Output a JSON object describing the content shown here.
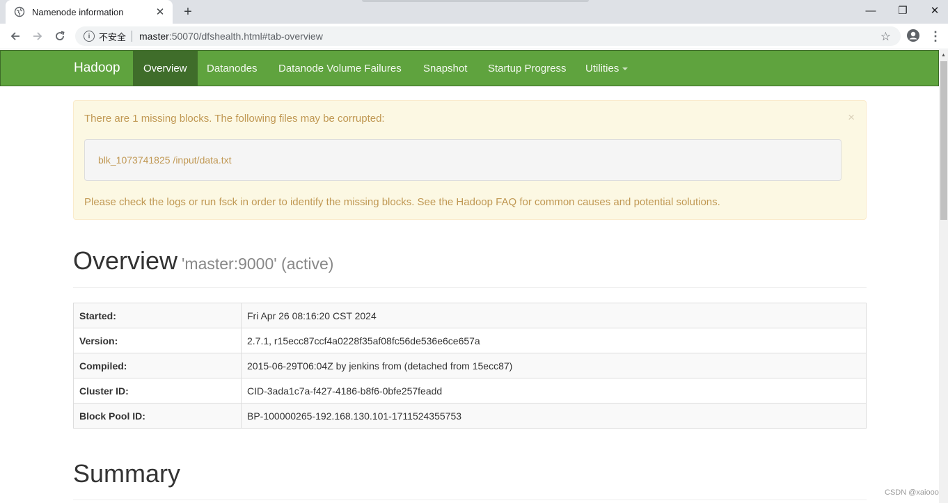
{
  "browser": {
    "tab_title": "Namenode information",
    "tab_close": "✕",
    "new_tab": "+",
    "window_controls": {
      "minimize": "—",
      "restore": "❐",
      "close": "✕"
    },
    "security_label": "不安全",
    "url_host": "master",
    "url_rest": ":50070/dfshealth.html#tab-overview",
    "icons": [
      "back-arrow-icon",
      "forward-arrow-icon",
      "reload-icon",
      "info-icon",
      "star-icon",
      "profile-icon",
      "menu-dots-icon"
    ]
  },
  "navbar": {
    "brand": "Hadoop",
    "items": [
      {
        "label": "Overview",
        "active": true
      },
      {
        "label": "Datanodes"
      },
      {
        "label": "Datanode Volume Failures"
      },
      {
        "label": "Snapshot"
      },
      {
        "label": "Startup Progress"
      },
      {
        "label": "Utilities"
      }
    ],
    "colors": {
      "bar": "#5fa33e",
      "active": "#3f6d2a"
    }
  },
  "alert": {
    "message": "There are 1 missing blocks. The following files may be corrupted:",
    "block": "blk_1073741825 /input/data.txt",
    "advice": "Please check the logs or run fsck in order to identify the missing blocks. See the Hadoop FAQ for common causes and potential solutions.",
    "close": "×"
  },
  "overview": {
    "title": "Overview",
    "subtitle": "'master:9000' (active)",
    "rows": [
      {
        "label": "Started:",
        "value": "Fri Apr 26 08:16:20 CST 2024"
      },
      {
        "label": "Version:",
        "value": "2.7.1, r15ecc87ccf4a0228f35af08fc56de536e6ce657a"
      },
      {
        "label": "Compiled:",
        "value": "2015-06-29T06:04Z by jenkins from (detached from 15ecc87)"
      },
      {
        "label": "Cluster ID:",
        "value": "CID-3ada1c7a-f427-4186-b8f6-0bfe257feadd"
      },
      {
        "label": "Block Pool ID:",
        "value": "BP-100000265-192.168.130.101-1711524355753"
      }
    ]
  },
  "summary": {
    "title": "Summary"
  },
  "watermark": "CSDN @xaiooo"
}
